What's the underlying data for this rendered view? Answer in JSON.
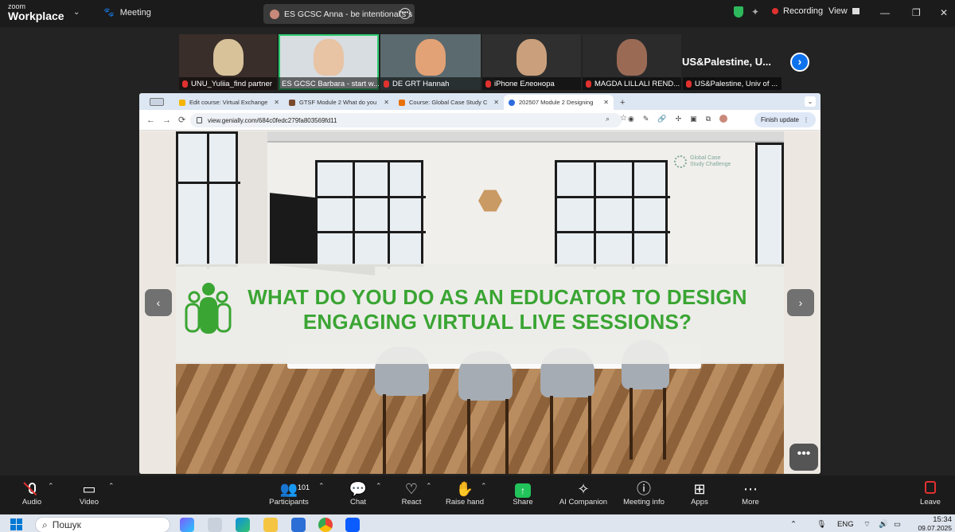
{
  "app": {
    "logo_line1": "zoom",
    "logo_line2": "Workplace"
  },
  "header": {
    "meeting_label": "Meeting",
    "share_tab": "ES GCSC Anna - be intentional's s",
    "recording_label": "Recording",
    "view_label": "View"
  },
  "participants": [
    {
      "name": "UNU_Yuliia_find partner",
      "muted": true,
      "face": "#d8c29a"
    },
    {
      "name": "ES GCSC Barbara - start w...",
      "muted": false,
      "face": "#e8c3a4"
    },
    {
      "name": "DE GRT Hannah",
      "muted": true,
      "face": "#e3a276"
    },
    {
      "name": "iPhone Елеонора",
      "muted": true,
      "face": "#caa07c"
    },
    {
      "name": "MAGDA LILLALI REND...",
      "muted": true,
      "face": "#9b6a55"
    },
    {
      "name": "US&Palestine, Univ of ...",
      "muted": true,
      "face": ""
    }
  ],
  "featured_name": "US&Palestine, U...",
  "browser": {
    "tabs": [
      {
        "title": "Edit course: Virtual Exchange",
        "color": "#f5b400"
      },
      {
        "title": "GTSF Module 2 What do you",
        "color": "#7a4a2e"
      },
      {
        "title": "Course: Global Case Study C",
        "color": "#e8710a"
      },
      {
        "title": "202507 Module 2 Designing",
        "color": "#2d6cdf"
      }
    ],
    "url": "view.genially.com/684c0fedc279fa803569fd11",
    "finish_update": "Finish update"
  },
  "slide": {
    "logo_line1": "Global Case",
    "logo_line2": "Study Challenge",
    "title_line1": "WHAT DO YOU DO AS AN EDUCATOR TO DESIGN",
    "title_line2": "ENGAGING VIRTUAL LIVE SESSIONS?",
    "accent": "#3aa533"
  },
  "toolbar": {
    "audio": "Audio",
    "video": "Video",
    "participants": "Participants",
    "participants_count": "101",
    "chat": "Chat",
    "react": "React",
    "raise_hand": "Raise hand",
    "share": "Share",
    "ai_companion": "AI Companion",
    "meeting_info": "Meeting info",
    "apps": "Apps",
    "more": "More",
    "leave": "Leave"
  },
  "taskbar": {
    "search_placeholder": "Пошук",
    "lang": "ENG",
    "time": "15:34",
    "date": "09.07.2025"
  }
}
